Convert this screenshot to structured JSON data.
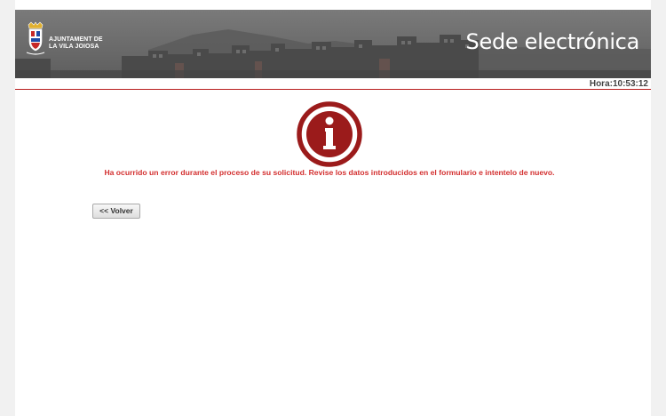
{
  "header": {
    "org_line1": "AJUNTAMENT DE",
    "org_line2": "LA VILA JOIOSA",
    "site_title": "Sede electrónica"
  },
  "clock": {
    "text": "Hora:10:53:12"
  },
  "main": {
    "error_message": "Ha ocurrido un error durante el proceso de su solicitud. Revise los datos introducidos en el formulario e intentelo de nuevo.",
    "back_button_label": "<< Volver"
  },
  "colors": {
    "accent": "#b71c1c",
    "error_text": "#d32f2f",
    "icon": "#9b1b1b"
  },
  "icons": {
    "logo": "coat-of-arms-icon",
    "status": "info-icon"
  }
}
